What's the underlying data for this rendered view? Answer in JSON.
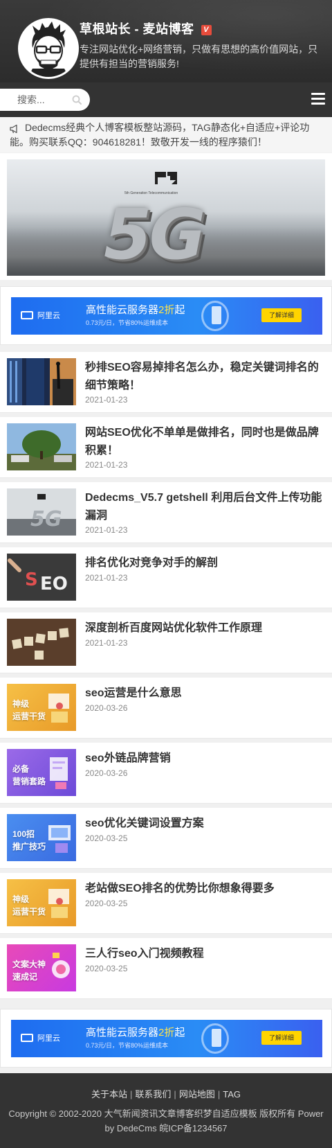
{
  "header": {
    "title": "草根站长 - 麦站博客",
    "verified_badge": "V",
    "description": "专注网站优化+网络营销，只做有思想的高价值网站，只提供有担当的营销服务!"
  },
  "search": {
    "placeholder": "搜索...",
    "icon": "search-icon"
  },
  "notice": {
    "icon": "megaphone-icon",
    "text": "Dedecms经典个人博客模板整站源码，TAG静态化+自适应+评论功能。购买联系QQ：904618281！致敬开发一线的程序猿们！"
  },
  "banner": {
    "big_text": "5G",
    "caption": "5th Generation Telecommunication"
  },
  "ads": [
    {
      "brand": "阿里云",
      "title_prefix": "高性能云服务器",
      "title_highlight": "2折",
      "title_suffix": "起",
      "subtitle": "0.73元/日，节省80%运维成本",
      "button": "了解详细"
    },
    {
      "brand": "阿里云",
      "title_prefix": "高性能云服务器",
      "title_highlight": "2折",
      "title_suffix": "起",
      "subtitle": "0.73元/日，节省80%运维成本",
      "button": "了解详细"
    }
  ],
  "articles": [
    {
      "title": "秒排SEO容易掉排名怎么办，稳定关键词排名的细节策略！",
      "date": "2021-01-23"
    },
    {
      "title": "网站SEO优化不单单是做排名，同时也是做品牌积累！",
      "date": "2021-01-23"
    },
    {
      "title": "Dedecms_V5.7 getshell 利用后台文件上传功能漏洞",
      "date": "2021-01-23"
    },
    {
      "title": "排名优化对竞争对手的解剖",
      "date": "2021-01-23"
    },
    {
      "title": "深度剖析百度网站优化软件工作原理",
      "date": "2021-01-23"
    },
    {
      "title": "seo运营是什么意思",
      "date": "2020-03-26",
      "thumb_label": "神级\n运营干货"
    },
    {
      "title": "seo外链品牌营销",
      "date": "2020-03-26",
      "thumb_label": "必备\n营销套路"
    },
    {
      "title": "seo优化关键词设置方案",
      "date": "2020-03-25",
      "thumb_label": "100招\n推广技巧"
    },
    {
      "title": "老站做SEO排名的优势比你想象得要多",
      "date": "2020-03-25",
      "thumb_label": "神级\n运营干货"
    },
    {
      "title": "三人行seo入门视频教程",
      "date": "2020-03-25",
      "thumb_label": "文案大神\n速成记"
    }
  ],
  "footer": {
    "links": [
      "关于本站",
      "联系我们",
      "网站地图",
      "TAG"
    ],
    "separator": "|",
    "copyright": "Copyright © 2002-2020 大气新闻资讯文章博客织梦自适应模板 版权所有 Power by DedeCms 皖ICP备1234567"
  },
  "colors": {
    "header_bg": "#333333",
    "badge_red": "#e74c3c",
    "ad_blue": "#1e6cf0",
    "ad_button_yellow": "#ffd400"
  }
}
